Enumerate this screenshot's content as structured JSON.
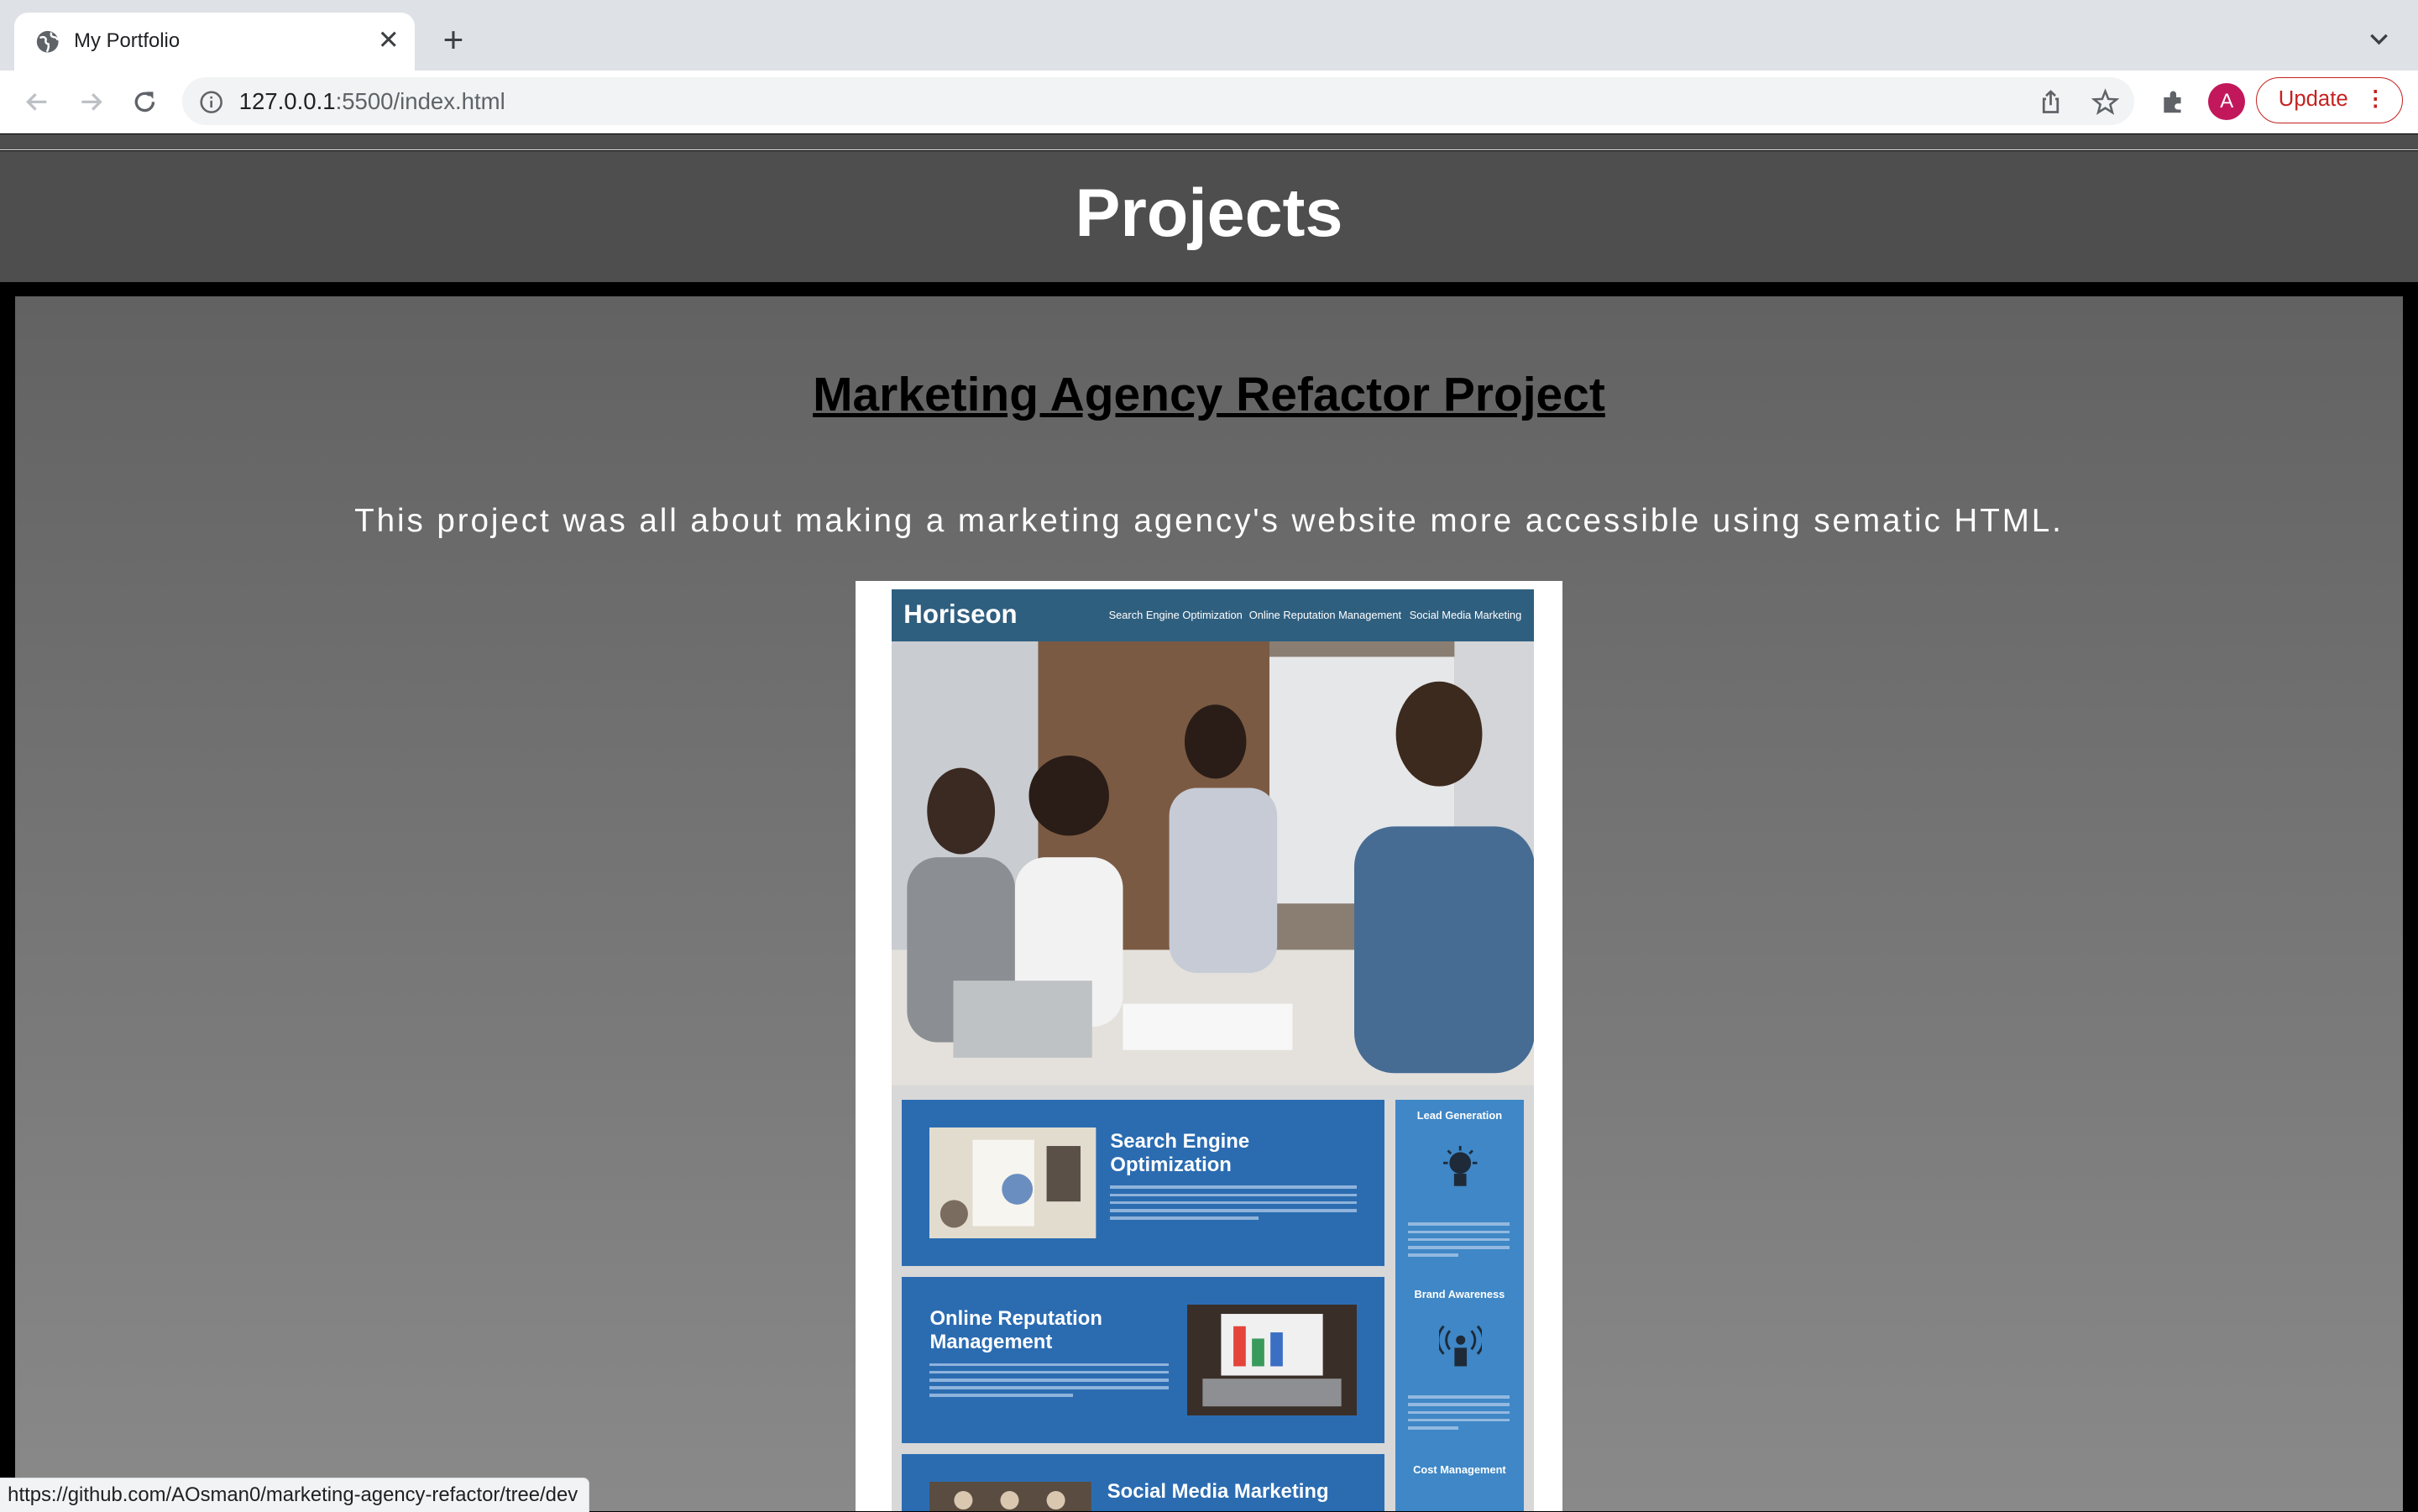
{
  "browser": {
    "tab_title": "My Portfolio",
    "url_host": "127.0.0.1",
    "url_rest": ":5500/index.html",
    "avatar_letter": "A",
    "update_label": "Update",
    "status_url": "https://github.com/AOsman0/marketing-agency-refactor/tree/dev"
  },
  "page": {
    "section_title": "Projects",
    "project": {
      "title": "Marketing Agency Refactor Project",
      "description": "This project was all about making a marketing agency's website more accessible using sematic HTML."
    },
    "preview": {
      "logo": "Horiseon",
      "nav": [
        "Search Engine Optimization",
        "Online Reputation Management",
        "Social Media Marketing"
      ],
      "boxes": [
        "Search Engine Optimization",
        "Online Reputation Management",
        "Social Media Marketing"
      ],
      "side": [
        "Lead Generation",
        "Brand Awareness",
        "Cost Management"
      ]
    }
  },
  "colors": {
    "section_head": "#4e4e4e",
    "mini_header": "#2f5f7f",
    "mini_box": "#2b6cb1",
    "update_accent": "#c5221f"
  }
}
